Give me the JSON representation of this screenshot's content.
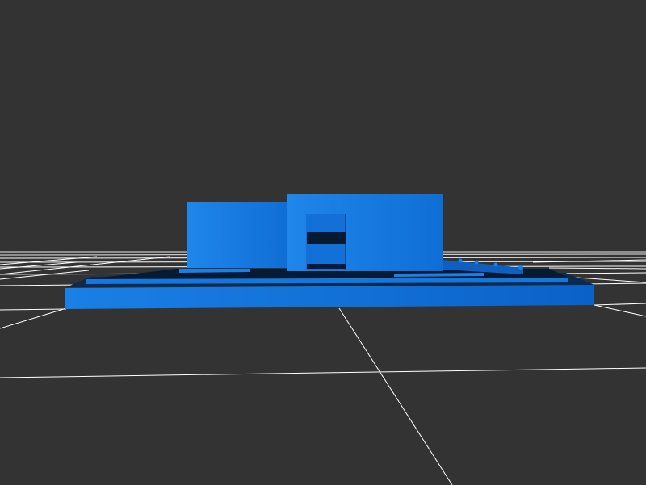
{
  "scene": {
    "background_color": "#333333",
    "grid_color": "#ffffff",
    "model_color": "#1a7ee0",
    "model_shadow_color": "#0b3f7a",
    "model_dark_color": "#061a33",
    "ground_grid_visible": true
  }
}
